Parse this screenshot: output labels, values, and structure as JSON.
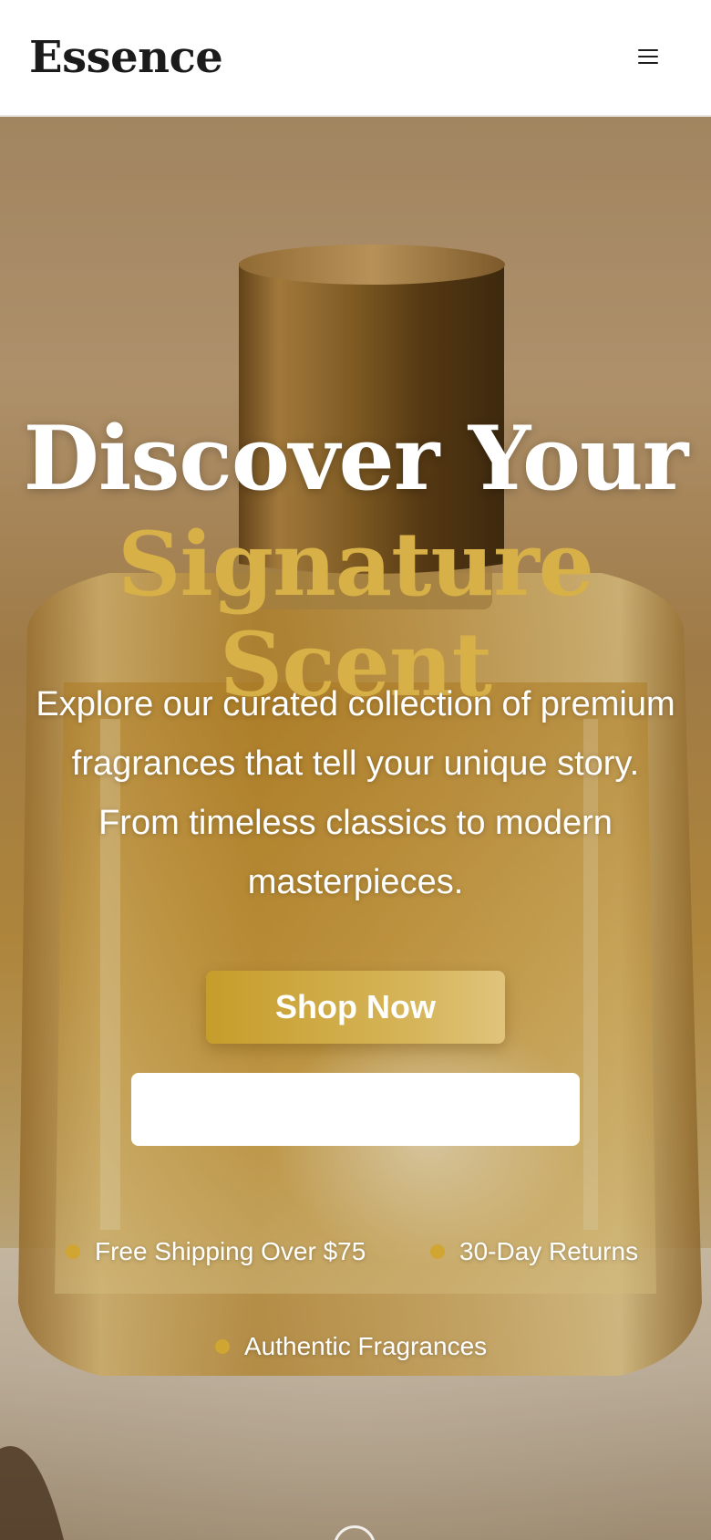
{
  "header": {
    "logo": "Essence",
    "menu_icon": "menu-icon"
  },
  "hero": {
    "title_line1": "Discover Your",
    "title_line2": "Signature Scent",
    "subtitle": "Explore our curated collection of premium fragrances that tell your unique story. From timeless classics to modern masterpieces.",
    "primary_button": "Shop Now",
    "secondary_button": "",
    "features": [
      {
        "label": "Free Shipping Over $75",
        "icon": "bullet-dot-icon"
      },
      {
        "label": "30-Day Returns",
        "icon": "bullet-dot-icon"
      },
      {
        "label": "Authentic Fragrances",
        "icon": "bullet-dot-icon"
      }
    ],
    "scroll_icon": "scroll-down-icon"
  },
  "colors": {
    "accent_gold": "#d7b048",
    "button_gold": "#c69d2b",
    "text_dark": "#1b1b1b",
    "header_bg": "#ffffff"
  }
}
